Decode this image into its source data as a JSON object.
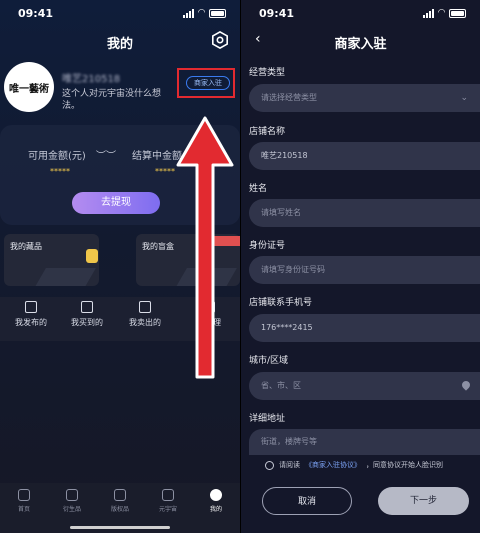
{
  "status_bar": {
    "time_left": "09:41",
    "time_right": "09:41"
  },
  "profile": {
    "title": "我的",
    "avatar_text": "唯一藝術",
    "username": "唯艺210518",
    "bio": "这个人对元宇宙没什么想法。",
    "merchant_tag": "商家入驻"
  },
  "wallet": {
    "available_label": "可用金额(元)",
    "available_value": "*****",
    "settling_label": "结算中金额(元)",
    "settling_value": "*****",
    "withdraw_button": "去提现"
  },
  "cards": {
    "collection": "我的藏品",
    "blindbox": "我的盲盒"
  },
  "menu": {
    "published": "我发布的",
    "bought": "我买到的",
    "sold": "我卖出的",
    "manage": "与管理"
  },
  "tabbar": [
    {
      "label": "首页"
    },
    {
      "label": "衍生品"
    },
    {
      "label": "版权品"
    },
    {
      "label": "元宇宙"
    },
    {
      "label": "我的"
    }
  ],
  "merchant_form": {
    "title": "商家入驻",
    "business_type_label": "经营类型",
    "business_type_placeholder": "请选择经营类型",
    "store_name_label": "店铺名称",
    "store_name_value": "唯艺210518",
    "name_label": "姓名",
    "name_placeholder": "请填写姓名",
    "id_label": "身份证号",
    "id_placeholder": "请填写身份证号码",
    "phone_label": "店铺联系手机号",
    "phone_value": "176****2415",
    "city_label": "城市/区域",
    "city_placeholder": "省、市、区",
    "address_label": "详细地址",
    "address_placeholder": "街道，楼牌号等",
    "agree_prefix": "请阅读",
    "agree_link": "《商家入驻协议》",
    "agree_suffix": "，同意协议开始人脸识别",
    "cancel_button": "取消",
    "next_button": "下一步"
  },
  "colors": {
    "highlight": "#e22a30",
    "accent": "#3a7bf0",
    "withdraw": "#9b7ef0"
  }
}
